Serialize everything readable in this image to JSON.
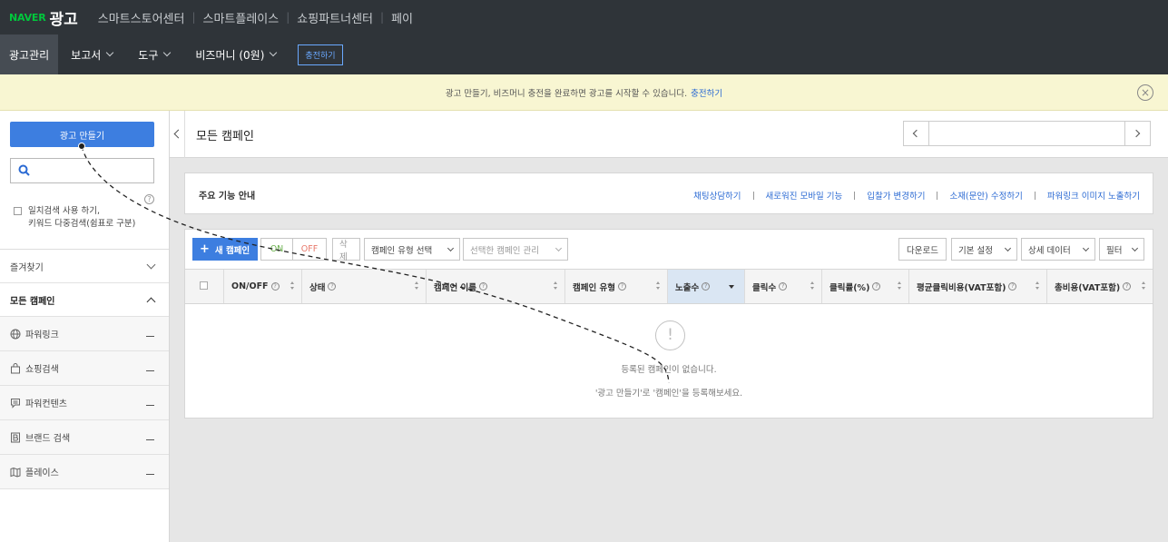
{
  "topbar": {
    "brand": "NAVER",
    "product": "광고",
    "nav": [
      "스마트스토어센터",
      "스마트플레이스",
      "쇼핑파트너센터",
      "페이"
    ]
  },
  "menubar": {
    "items": [
      {
        "label": "광고관리"
      },
      {
        "label": "보고서"
      },
      {
        "label": "도구"
      },
      {
        "label": "비즈머니 (0원)"
      }
    ],
    "charge_label": "충전하기"
  },
  "notice": {
    "text": "광고 만들기, 비즈머니 충전을 완료하면 광고를 시작할 수 있습니다.",
    "link": "충전하기"
  },
  "sidebar": {
    "create_label": "광고 만들기",
    "search_placeholder": "",
    "exact_line1": "일치검색 사용 하기,",
    "exact_line2": "키워드 다중검색(쉼표로 구분)",
    "favorites": "즐겨찾기",
    "all_campaigns": "모든 캠페인",
    "types": [
      {
        "label": "파워링크",
        "icon": "globe-icon"
      },
      {
        "label": "쇼핑검색",
        "icon": "shopping-bag-icon"
      },
      {
        "label": "파워컨텐츠",
        "icon": "speech-bubble-icon"
      },
      {
        "label": "브랜드 검색",
        "icon": "brand-b-icon"
      },
      {
        "label": "플레이스",
        "icon": "map-icon"
      }
    ]
  },
  "main": {
    "title": "모든 캠페인",
    "guide": {
      "title": "주요 기능 안내",
      "links": [
        "채팅상담하기",
        "새로워진 모바일 기능",
        "입찰가 변경하기",
        "소재(문안) 수정하기",
        "파워링크 이미지 노출하기"
      ]
    },
    "toolbar": {
      "new_campaign": "새 캠페인",
      "on": "ON",
      "off": "OFF",
      "delete": "삭제",
      "campaign_type": "캠페인 유형 선택",
      "manage_selected": "선택한 캠페인 관리",
      "download": "다운로드",
      "basic_settings": "기본 설정",
      "detail_data": "상세 데이터",
      "filter": "필터"
    },
    "columns": [
      "ON/OFF",
      "상태",
      "캠페인 이름",
      "캠페인 유형",
      "노출수",
      "클릭수",
      "클릭률(%)",
      "평균클릭비용(VAT포함)",
      "총비용(VAT포함)"
    ],
    "empty_line1": "등록된 캠페인이 없습니다.",
    "empty_line2": "'광고 만들기'로 '캠페인'을 등록해보세요."
  }
}
